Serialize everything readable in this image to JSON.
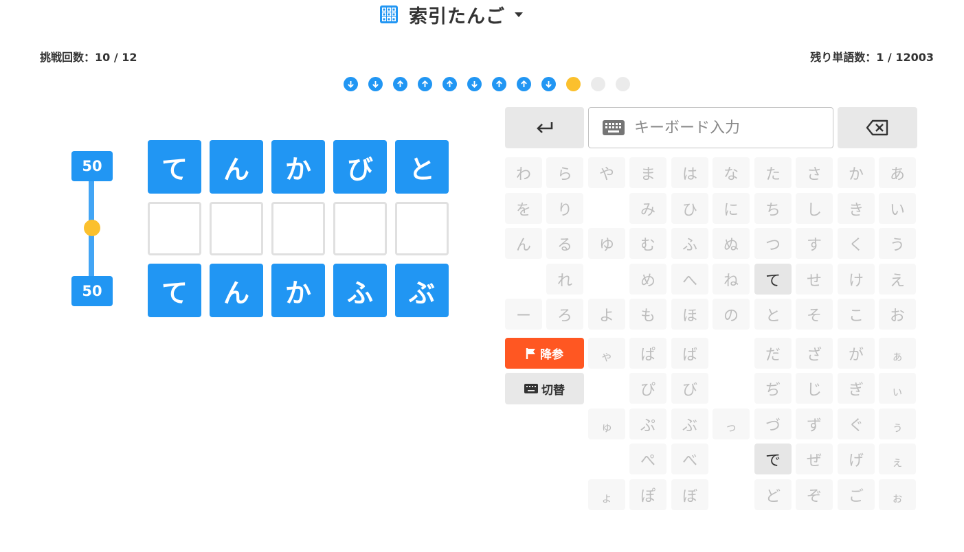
{
  "header": {
    "title": "索引たんご",
    "icon": "grid-icon"
  },
  "stats": {
    "attempts": "挑戦回数：10 / 12",
    "remaining": "残り単語数：1 / 12003"
  },
  "history": [
    "down",
    "down",
    "up",
    "up",
    "up",
    "down",
    "up",
    "up",
    "down",
    "current",
    "empty",
    "empty"
  ],
  "slider": {
    "top_value": "50",
    "bottom_value": "50"
  },
  "rows": [
    {
      "state": "filled",
      "letters": [
        "て",
        "ん",
        "か",
        "び",
        "と"
      ]
    },
    {
      "state": "empty",
      "letters": [
        "",
        "",
        "",
        "",
        ""
      ]
    },
    {
      "state": "filled",
      "letters": [
        "て",
        "ん",
        "か",
        "ふ",
        "ぶ"
      ]
    }
  ],
  "keyboard": {
    "input_placeholder": "キーボード入力",
    "surrender_label": "降参",
    "switch_label": "切替",
    "main_grid": [
      [
        "わ",
        "ら",
        "や",
        "ま",
        "は",
        "な",
        "た",
        "さ",
        "か",
        "あ"
      ],
      [
        "を",
        "り",
        "",
        "み",
        "ひ",
        "に",
        "ち",
        "し",
        "き",
        "い"
      ],
      [
        "ん",
        "る",
        "ゆ",
        "む",
        "ふ",
        "ぬ",
        "つ",
        "す",
        "く",
        "う"
      ],
      [
        "",
        "れ",
        "",
        "め",
        "へ",
        "ね",
        "て",
        "せ",
        "け",
        "え"
      ],
      [
        "ー",
        "ろ",
        "よ",
        "も",
        "ほ",
        "の",
        "と",
        "そ",
        "こ",
        "お"
      ]
    ],
    "sub_grid": [
      [
        "ゃ",
        "ぱ",
        "ば",
        "",
        "だ",
        "ざ",
        "が",
        "ぁ"
      ],
      [
        "",
        "ぴ",
        "び",
        "",
        "ぢ",
        "じ",
        "ぎ",
        "ぃ"
      ],
      [
        "ゅ",
        "ぷ",
        "ぶ",
        "っ",
        "づ",
        "ず",
        "ぐ",
        "ぅ"
      ],
      [
        "",
        "ぺ",
        "べ",
        "",
        "で",
        "ぜ",
        "げ",
        "ぇ"
      ],
      [
        "ょ",
        "ぽ",
        "ぼ",
        "",
        "ど",
        "ぞ",
        "ご",
        "ぉ"
      ]
    ],
    "active_keys": [
      "て",
      "で"
    ],
    "small_keys": [
      "ゃ",
      "ゅ",
      "ょ",
      "っ",
      "ぁ",
      "ぃ",
      "ぅ",
      "ぇ",
      "ぉ"
    ]
  },
  "colors": {
    "primary": "#2196f3",
    "accent": "#fbc02d",
    "danger": "#ff5722",
    "key_bg": "#f7f7f7"
  }
}
